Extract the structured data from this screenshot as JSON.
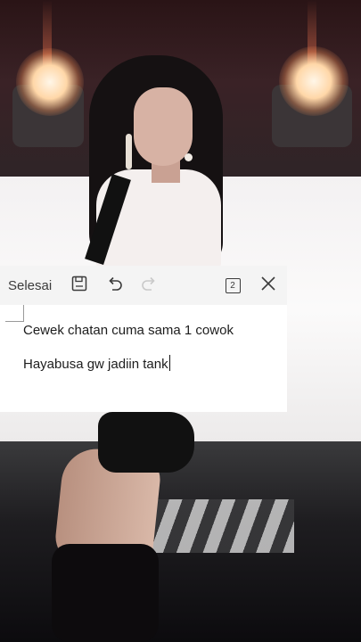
{
  "toolbar": {
    "done_label": "Selesai",
    "page_count": "2"
  },
  "editor": {
    "lines": [
      "Cewek chatan cuma sama 1 cowok",
      "Hayabusa gw jadiin tank"
    ]
  }
}
